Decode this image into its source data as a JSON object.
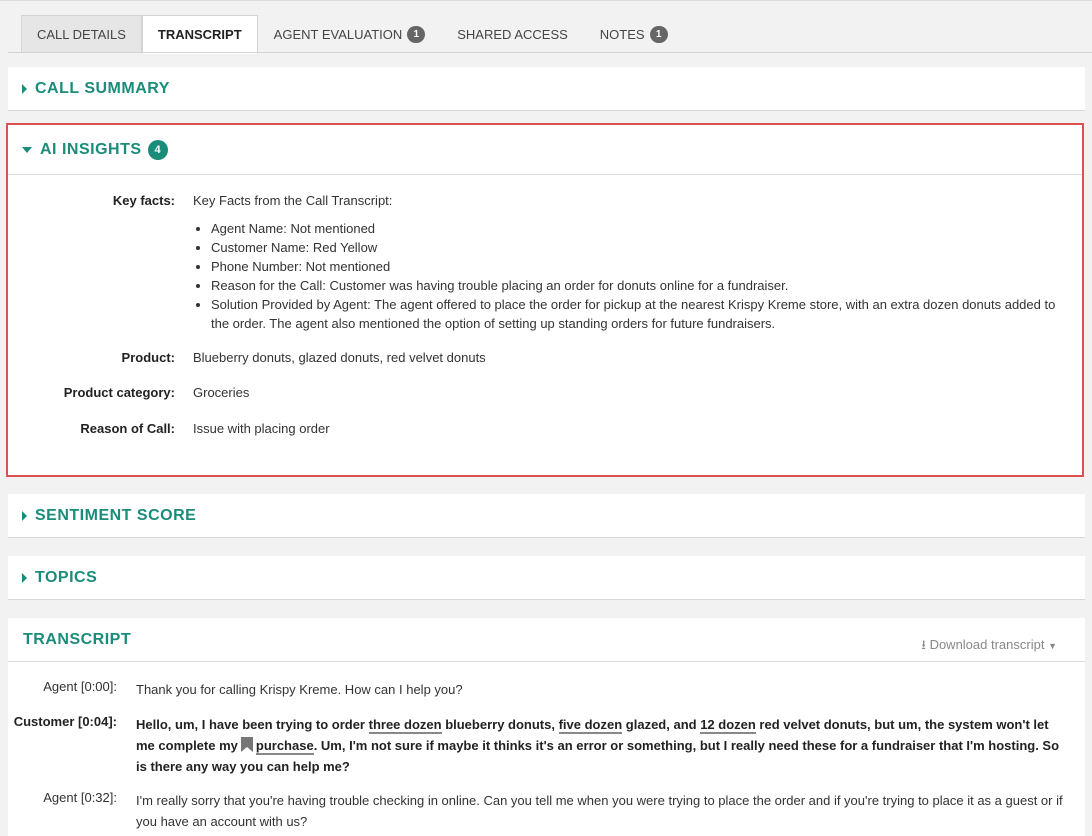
{
  "tabs": [
    {
      "label": "CALL DETAILS"
    },
    {
      "label": "TRANSCRIPT"
    },
    {
      "label": "AGENT EVALUATION",
      "count": "1"
    },
    {
      "label": "SHARED ACCESS"
    },
    {
      "label": "NOTES",
      "count": "1"
    }
  ],
  "panels": {
    "call_summary": "CALL SUMMARY",
    "ai_insights": "AI INSIGHTS",
    "ai_insights_count": "4",
    "sentiment": "SENTIMENT SCORE",
    "topics": "TOPICS",
    "transcript": "TRANSCRIPT"
  },
  "insights": {
    "key_facts_label": "Key facts:",
    "key_facts_intro": "Key Facts from the Call Transcript:",
    "key_facts": [
      "Agent Name: Not mentioned",
      "Customer Name: Red Yellow",
      "Phone Number: Not mentioned",
      "Reason for the Call: Customer was having trouble placing an order for donuts online for a fundraiser.",
      "Solution Provided by Agent: The agent offered to place the order for pickup at the nearest Krispy Kreme store, with an extra dozen donuts added to the order. The agent also mentioned the option of setting up standing orders for future fundraisers."
    ],
    "product_label": "Product:",
    "product": "Blueberry donuts, glazed donuts, red velvet donuts",
    "category_label": "Product category:",
    "category": "Groceries",
    "reason_label": "Reason of Call:",
    "reason": "Issue with placing order"
  },
  "transcript": {
    "download": "Download transcript",
    "lines": [
      {
        "speaker": "Agent [0:00]:",
        "text": "Thank you for calling Krispy Kreme. How can I help you?"
      },
      {
        "speaker": "Customer [0:04]:",
        "parts": [
          "Hello, um, I have been trying to order ",
          "three dozen",
          " blueberry donuts, ",
          "five dozen",
          " glazed, and ",
          "12 dozen",
          " red velvet donuts, but um, the system won't let me complete my",
          "purchase",
          ". Um, I'm not sure if maybe it thinks it's an error or something, but I really need these for a fundraiser that I'm hosting. So is there any way you can help me?"
        ]
      },
      {
        "speaker": "Agent [0:32]:",
        "text": "I'm really sorry that you're having trouble checking in online. Can you tell me when you were trying to place the order and if you're trying to place it as a guest or if you have an account with us?"
      }
    ]
  },
  "colors": {
    "accent": "#1a8c7a",
    "highlight_border": "#d9534f"
  }
}
